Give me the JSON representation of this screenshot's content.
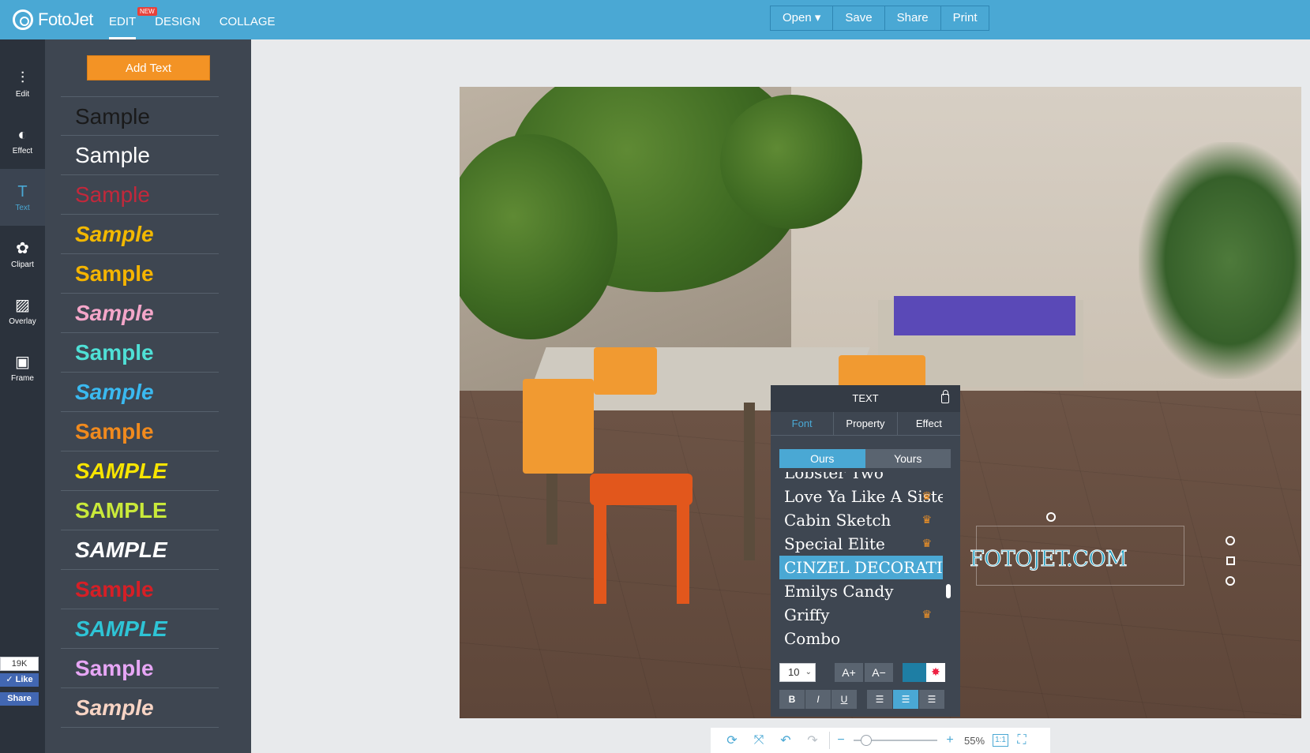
{
  "app": {
    "logo_text": "FotoJet",
    "nav": [
      {
        "label": "EDIT",
        "active": true,
        "badge": "NEW"
      },
      {
        "label": "DESIGN"
      },
      {
        "label": "COLLAGE"
      }
    ],
    "file_menu": {
      "open": "Open ▾",
      "save": "Save",
      "share": "Share",
      "print": "Print"
    }
  },
  "rail": [
    {
      "label": "Edit",
      "icon": "sliders-icon"
    },
    {
      "label": "Effect",
      "icon": "half-circle-icon"
    },
    {
      "label": "Text",
      "icon": "text-t-icon",
      "active": true
    },
    {
      "label": "Clipart",
      "icon": "flower-icon"
    },
    {
      "label": "Overlay",
      "icon": "overlay-icon"
    },
    {
      "label": "Frame",
      "icon": "frame-icon"
    }
  ],
  "social": {
    "count": "19K",
    "like": "Like",
    "share": "Share"
  },
  "text_panel": {
    "add_text": "Add Text",
    "samples": [
      {
        "text": "Sample",
        "color": "#1a1a1a"
      },
      {
        "text": "Sample",
        "color": "#ffffff"
      },
      {
        "text": "Sample",
        "color": "#c2283b"
      },
      {
        "text": "Sample",
        "color": "#f2b800"
      },
      {
        "text": "Sample",
        "color": "#f5b400"
      },
      {
        "text": "Sample",
        "color": "#f4a6c9"
      },
      {
        "text": "Sample",
        "color": "#4fe0d6"
      },
      {
        "text": "Sample",
        "color": "#3ab9f0"
      },
      {
        "text": "Sample",
        "color": "#f08a1e"
      },
      {
        "text": "SAMPLE",
        "color": "#f7e400"
      },
      {
        "text": "SAMPLE",
        "color": "#c9e93a"
      },
      {
        "text": "SAMPLE",
        "color": "#ffffff"
      },
      {
        "text": "Sample",
        "color": "#d61f26"
      },
      {
        "text": "SAMPLE",
        "color": "#2ec4d6"
      },
      {
        "text": "Sample",
        "color": "#e7a6f5"
      },
      {
        "text": "Sample",
        "color": "#f7d4c4"
      }
    ]
  },
  "canvas": {
    "text_object": "FOTOJET.COM"
  },
  "text_popup": {
    "title": "TEXT",
    "tabs": [
      "Font",
      "Property",
      "Effect"
    ],
    "active_tab": "Font",
    "source_tabs": [
      "Ours",
      "Yours"
    ],
    "fonts": [
      {
        "name": "Lobster Two",
        "premium": false
      },
      {
        "name": "Love Ya Like A Sister",
        "premium": true
      },
      {
        "name": "Cabin Sketch",
        "premium": true
      },
      {
        "name": "Special Elite",
        "premium": true
      },
      {
        "name": "CINZEL DECORATIVE",
        "premium": false,
        "selected": true
      },
      {
        "name": "Emilys Candy",
        "premium": false
      },
      {
        "name": "Griffy",
        "premium": true
      },
      {
        "name": "Combo",
        "premium": false
      }
    ],
    "size": "10",
    "increase": "A+",
    "decrease": "A−",
    "text_color": "#1e7ea4",
    "format": {
      "bold": "B",
      "italic": "I",
      "underline": "U"
    }
  },
  "bottom_toolbar": {
    "zoom_minus": "−",
    "zoom_plus": "+",
    "zoom": "55%",
    "zoom_level": 0.1,
    "actual_size": "1:1"
  }
}
